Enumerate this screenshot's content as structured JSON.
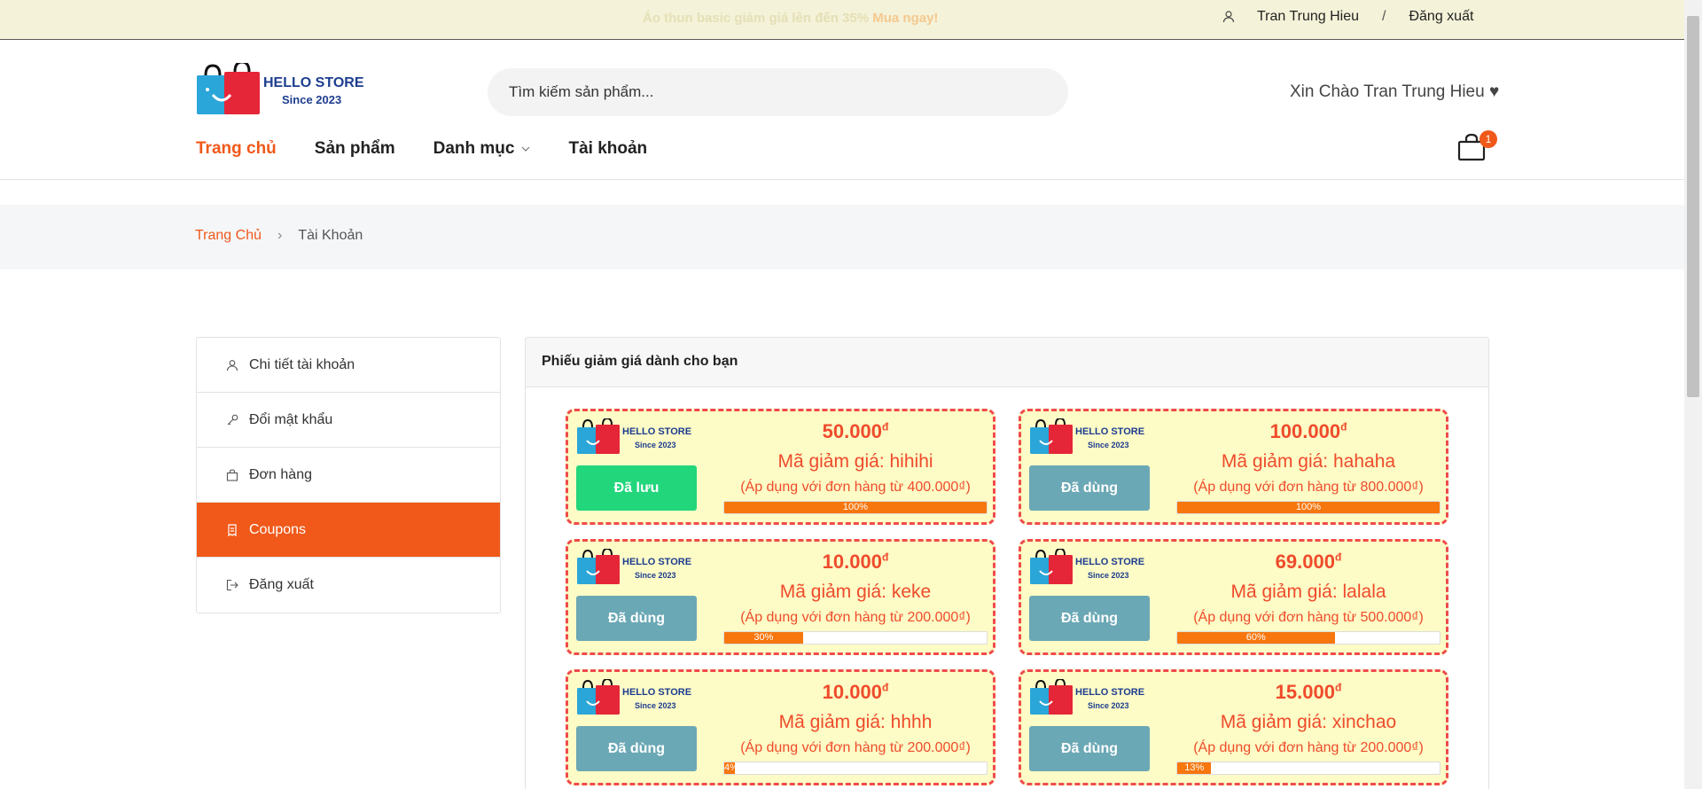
{
  "topbar": {
    "promo_text": "Áo thun basic giảm giá lên đến 35%",
    "promo_link": "Mua ngay!",
    "username": "Tran Trung Hieu",
    "separator": "/",
    "logout": "Đăng xuất"
  },
  "header": {
    "logo_text": "HELLO STORE",
    "logo_sub": "Since 2023",
    "search_placeholder": "Tìm kiếm sản phẩm...",
    "greeting": "Xin Chào Tran Trung Hieu ♥",
    "cart_count": "1"
  },
  "nav": [
    {
      "label": "Trang chủ",
      "active": true
    },
    {
      "label": "Sản phẩm",
      "active": false
    },
    {
      "label": "Danh mục",
      "active": false,
      "dropdown": true
    },
    {
      "label": "Tài khoản",
      "active": false
    }
  ],
  "breadcrumb": {
    "home": "Trang Chủ",
    "arrow": "›",
    "current": "Tài Khoản"
  },
  "sidebar": {
    "items": [
      {
        "label": "Chi tiết tài khoản",
        "icon": "user-icon"
      },
      {
        "label": "Đổi mật khẩu",
        "icon": "key-icon"
      },
      {
        "label": "Đơn hàng",
        "icon": "bag-icon"
      },
      {
        "label": "Coupons",
        "icon": "coupon-icon",
        "active": true
      },
      {
        "label": "Đăng xuất",
        "icon": "logout-icon"
      }
    ]
  },
  "coupons_panel": {
    "title": "Phiếu giảm giá dành cho bạn",
    "coupons": [
      {
        "amount": "50.000",
        "currency": "đ",
        "code": "Mã giảm giá: hihihi",
        "condition": "(Áp dụng với đơn hàng từ 400.000₫)",
        "button": "Đã lưu",
        "state": "saved",
        "progress": 100,
        "progress_label": "100%"
      },
      {
        "amount": "100.000",
        "currency": "đ",
        "code": "Mã giảm giá: hahaha",
        "condition": "(Áp dụng với đơn hàng từ 800.000₫)",
        "button": "Đã dùng",
        "state": "used",
        "progress": 100,
        "progress_label": "100%"
      },
      {
        "amount": "10.000",
        "currency": "đ",
        "code": "Mã giảm giá: keke",
        "condition": "(Áp dụng với đơn hàng từ 200.000₫)",
        "button": "Đã dùng",
        "state": "used",
        "progress": 30,
        "progress_label": "30%"
      },
      {
        "amount": "69.000",
        "currency": "đ",
        "code": "Mã giảm giá: lalala",
        "condition": "(Áp dụng với đơn hàng từ 500.000₫)",
        "button": "Đã dùng",
        "state": "used",
        "progress": 60,
        "progress_label": "60%"
      },
      {
        "amount": "10.000",
        "currency": "đ",
        "code": "Mã giảm giá: hhhh",
        "condition": "(Áp dụng với đơn hàng từ 200.000₫)",
        "button": "Đã dùng",
        "state": "used",
        "progress": 4,
        "progress_label": "4%"
      },
      {
        "amount": "15.000",
        "currency": "đ",
        "code": "Mã giảm giá: xinchao",
        "condition": "(Áp dụng với đơn hàng từ 200.000₫)",
        "button": "Đã dùng",
        "state": "used",
        "progress": 13,
        "progress_label": "13%"
      }
    ]
  },
  "colors": {
    "accent": "#f0591a",
    "coupon_bg": "#fdfbc6",
    "coupon_border": "#ef4b4b",
    "saved_button": "#22d67c",
    "used_button": "#6ba8b5",
    "progress": "#f7760e"
  }
}
